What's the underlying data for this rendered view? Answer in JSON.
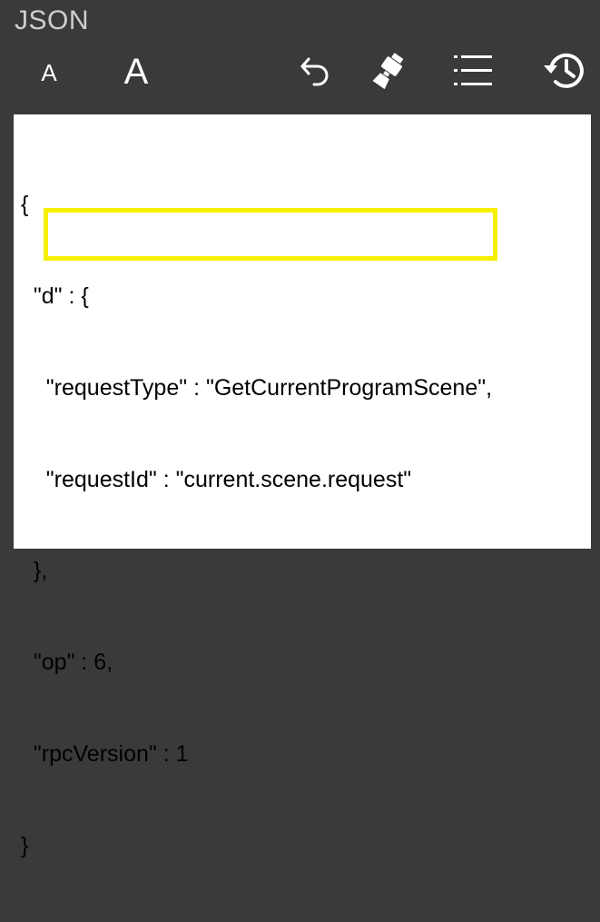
{
  "header": {
    "title": "JSON"
  },
  "toolbar": {
    "font_small_label": "A",
    "font_large_label": "A",
    "icons": [
      "undo-icon",
      "brush-icon",
      "list-icon",
      "history-icon"
    ]
  },
  "editor": {
    "lines": [
      "{",
      "  \"d\" : {",
      "    \"requestType\" : \"GetCurrentProgramScene\",",
      "    \"requestId\" : \"current.scene.request\"",
      "  },",
      "  \"op\" : 6,",
      "  \"rpcVersion\" : 1",
      "}"
    ]
  },
  "colors": {
    "background": "#3a3a3c",
    "highlight": "#f6f000",
    "editor_bg": "#ffffff"
  }
}
